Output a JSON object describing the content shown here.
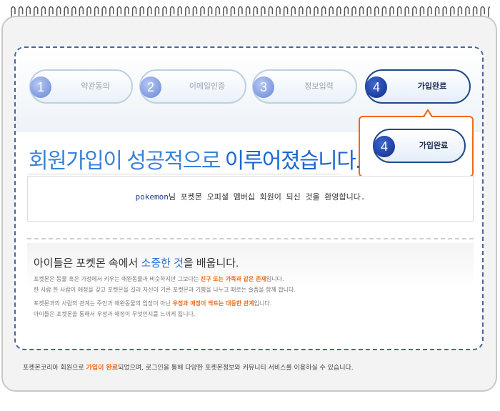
{
  "steps": [
    {
      "num": "1",
      "label": "약관동의",
      "active": false
    },
    {
      "num": "2",
      "label": "이메일인증",
      "active": false
    },
    {
      "num": "3",
      "label": "정보입력",
      "active": false
    },
    {
      "num": "4",
      "label": "가입완료",
      "active": true
    }
  ],
  "callout": {
    "num": "4",
    "label": "가입완료"
  },
  "success": {
    "prefix": "회원가입이 성공적으로 ",
    "highlight": "이루어졌습니다."
  },
  "welcome": {
    "username": "pokemon",
    "message": "님 포켓몬 오피셜 멤버십 회원이 되신 것을 환영합니다."
  },
  "section": {
    "heading_prefix": "아이들은 포켓몬 속에서 ",
    "heading_highlight": "소중한 것",
    "heading_suffix": "을 배웁니다."
  },
  "paragraphs": [
    {
      "before": "포켓몬은 동물 혹은 가정에서 키우는 애완동물과 비슷하지만 그보다는 ",
      "highlight": "친구 또는 가족과 같은 존재",
      "after": "입니다."
    },
    {
      "before": "한 사람 한 사람이 애정을 갖고 포켓몬을 길러 자신이 기른 포켓몬과 기쁨을 나누고 때로는 슬픔을 함께 합니다.",
      "highlight": "",
      "after": ""
    },
    {
      "before": "포켓몬과의 사람의 관계는 주인과 애완동물의 입장이 아닌 ",
      "highlight": "우정과 애정이 싹트는 대등한 관계",
      "after": "입니다."
    },
    {
      "before": "아이들은 포켓몬을 통해서 우정과 애정이 무엇인지를 느끼게 됩니다.",
      "highlight": "",
      "after": ""
    }
  ],
  "footer": {
    "before": "포켓몬코리아 회원으로 ",
    "highlight": "가입이 완료",
    "after": "되었으며, 로그인을 통해 다양한 포켓몬정보와 커뮤니티 서비스를 이용하실 수 있습니다."
  },
  "colors": {
    "accent_blue": "#1d66d2",
    "accent_orange": "#ea6c1d",
    "border_dark": "#46679a"
  },
  "icons": {
    "spiral": "notebook-spiral-icon"
  }
}
